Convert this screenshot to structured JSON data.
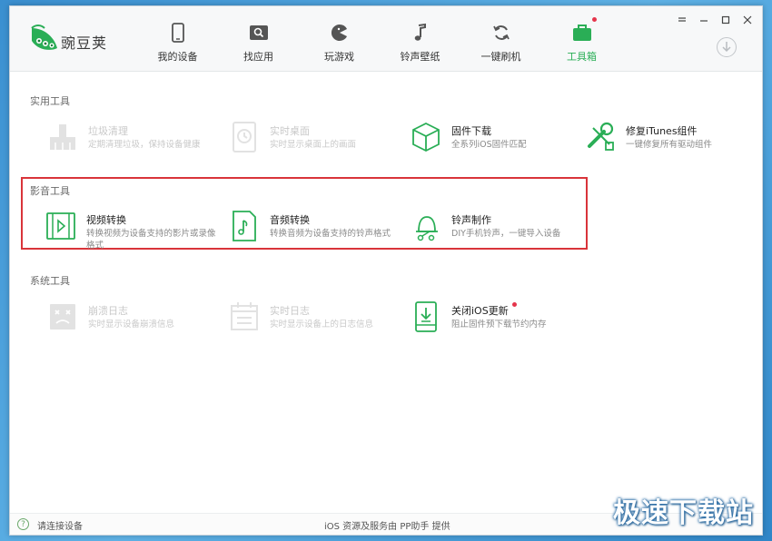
{
  "app": {
    "brand": "豌豆荚"
  },
  "nav": [
    {
      "label": "我的设备",
      "icon": "phone-icon"
    },
    {
      "label": "找应用",
      "icon": "app-search-icon"
    },
    {
      "label": "玩游戏",
      "icon": "pacman-icon"
    },
    {
      "label": "铃声壁纸",
      "icon": "music-note-icon"
    },
    {
      "label": "一键刷机",
      "icon": "refresh-icon"
    },
    {
      "label": "工具箱",
      "icon": "toolbox-icon",
      "active": true,
      "badge": true
    }
  ],
  "sections": {
    "utility": {
      "title": "实用工具",
      "tools": [
        {
          "name": "垃圾清理",
          "desc": "定期清理垃圾，保持设备健康",
          "enabled": false
        },
        {
          "name": "实时桌面",
          "desc": "实时显示桌面上的画面",
          "enabled": false
        },
        {
          "name": "固件下载",
          "desc": "全系列iOS固件匹配",
          "enabled": true
        },
        {
          "name": "修复iTunes组件",
          "desc": "一键修复所有驱动组件",
          "enabled": true
        }
      ]
    },
    "media": {
      "title": "影音工具",
      "tools": [
        {
          "name": "视频转换",
          "desc": "转换视频为设备支持的影片或录像格式",
          "enabled": true
        },
        {
          "name": "音频转换",
          "desc": "转换音频为设备支持的铃声格式",
          "enabled": true
        },
        {
          "name": "铃声制作",
          "desc": "DIY手机铃声，一键导入设备",
          "enabled": true
        }
      ]
    },
    "system": {
      "title": "系统工具",
      "tools": [
        {
          "name": "崩溃日志",
          "desc": "实时显示设备崩溃信息",
          "enabled": false
        },
        {
          "name": "实时日志",
          "desc": "实时显示设备上的日志信息",
          "enabled": false
        },
        {
          "name": "关闭iOS更新",
          "desc": "阻止固件预下载节约内存",
          "enabled": true,
          "badge": true
        }
      ]
    }
  },
  "footer": {
    "status": "请连接设备",
    "center": "iOS 资源及服务由 PP助手 提供",
    "help": "?"
  },
  "watermark": "极速下载站",
  "colors": {
    "accent": "#2aae56",
    "badge": "#e5344b",
    "highlight": "#d9343a"
  }
}
